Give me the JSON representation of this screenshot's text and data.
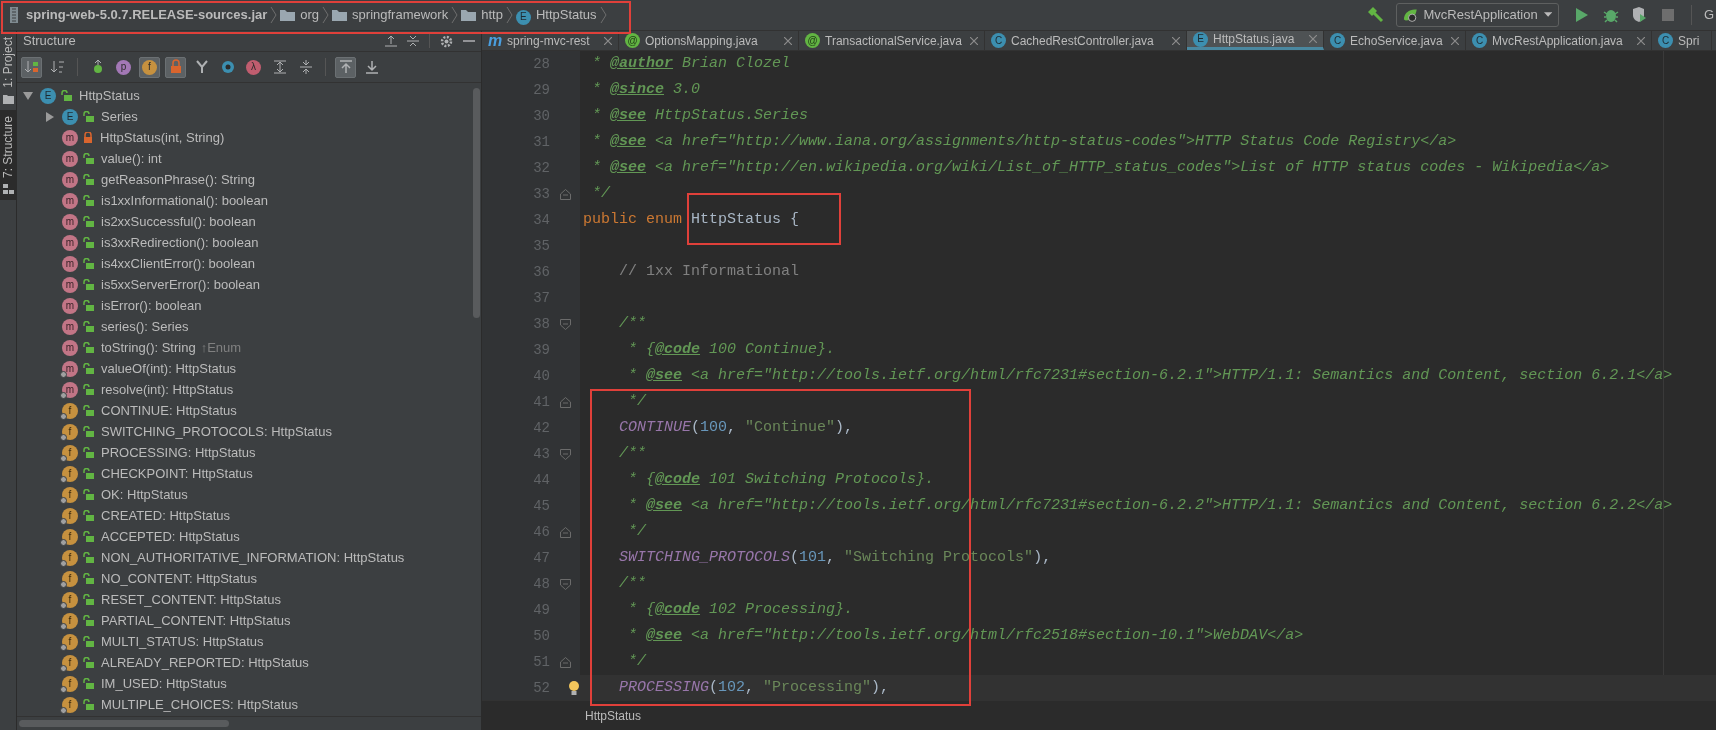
{
  "breadcrumbs": [
    {
      "kind": "jar",
      "label": "spring-web-5.0.7.RELEASE-sources.jar"
    },
    {
      "kind": "package",
      "label": "org"
    },
    {
      "kind": "package",
      "label": "springframework"
    },
    {
      "kind": "package",
      "label": "http"
    },
    {
      "kind": "enum",
      "glyph": "E",
      "label": "HttpStatus"
    }
  ],
  "run_toolbar": {
    "configuration": "MvcRestApplication",
    "cut_label": "G"
  },
  "tool_strip": [
    {
      "label": "1: Project",
      "selected": false
    },
    {
      "label": "7: Structure",
      "selected": true
    }
  ],
  "structure": {
    "title": "Structure",
    "toolbar": [
      {
        "kind": "sort-visibility",
        "active": true
      },
      {
        "kind": "sort-alpha",
        "active": false
      },
      {
        "kind": "inherited",
        "active": false
      },
      {
        "kind": "properties",
        "glyph": "p",
        "active": false
      },
      {
        "kind": "fields",
        "glyph": "f",
        "active": true
      },
      {
        "kind": "non-public",
        "active": true
      },
      {
        "kind": "hierarchy",
        "active": false
      },
      {
        "kind": "anonymous",
        "active": false
      },
      {
        "kind": "lambdas",
        "glyph": "λ",
        "active": false
      },
      {
        "kind": "expand",
        "active": false
      },
      {
        "kind": "collapse",
        "active": false
      },
      {
        "kind": "autoscroll-from",
        "active": true
      },
      {
        "kind": "autoscroll-to",
        "active": false
      }
    ],
    "tree": [
      {
        "label": "HttpStatus",
        "kind": "enum",
        "glyph": "E",
        "private": false,
        "static": false,
        "expanded": true,
        "children": [
          {
            "label": "Series",
            "kind": "enum",
            "glyph": "E",
            "private": false,
            "static": false,
            "expanded": false
          },
          {
            "label": "HttpStatus(int, String)",
            "kind": "method",
            "glyph": "m",
            "private": true,
            "static": false
          },
          {
            "label": "value(): int",
            "kind": "method",
            "glyph": "m",
            "private": false,
            "static": false
          },
          {
            "label": "getReasonPhrase(): String",
            "kind": "method",
            "glyph": "m",
            "private": false,
            "static": false
          },
          {
            "label": "is1xxInformational(): boolean",
            "kind": "method",
            "glyph": "m",
            "private": false,
            "static": false
          },
          {
            "label": "is2xxSuccessful(): boolean",
            "kind": "method",
            "glyph": "m",
            "private": false,
            "static": false
          },
          {
            "label": "is3xxRedirection(): boolean",
            "kind": "method",
            "glyph": "m",
            "private": false,
            "static": false
          },
          {
            "label": "is4xxClientError(): boolean",
            "kind": "method",
            "glyph": "m",
            "private": false,
            "static": false
          },
          {
            "label": "is5xxServerError(): boolean",
            "kind": "method",
            "glyph": "m",
            "private": false,
            "static": false
          },
          {
            "label": "isError(): boolean",
            "kind": "method",
            "glyph": "m",
            "private": false,
            "static": false
          },
          {
            "label": "series(): Series",
            "kind": "method",
            "glyph": "m",
            "private": false,
            "static": false
          },
          {
            "label": "toString(): String",
            "suffix": "↑Enum",
            "kind": "method",
            "glyph": "m",
            "private": false,
            "static": false
          },
          {
            "label": "valueOf(int): HttpStatus",
            "kind": "method",
            "glyph": "m",
            "private": false,
            "static": true
          },
          {
            "label": "resolve(int): HttpStatus",
            "kind": "method",
            "glyph": "m",
            "private": false,
            "static": true
          },
          {
            "label": "CONTINUE: HttpStatus",
            "kind": "field",
            "glyph": "f",
            "private": false,
            "static": true
          },
          {
            "label": "SWITCHING_PROTOCOLS: HttpStatus",
            "kind": "field",
            "glyph": "f",
            "private": false,
            "static": true
          },
          {
            "label": "PROCESSING: HttpStatus",
            "kind": "field",
            "glyph": "f",
            "private": false,
            "static": true
          },
          {
            "label": "CHECKPOINT: HttpStatus",
            "kind": "field",
            "glyph": "f",
            "private": false,
            "static": true
          },
          {
            "label": "OK: HttpStatus",
            "kind": "field",
            "glyph": "f",
            "private": false,
            "static": true
          },
          {
            "label": "CREATED: HttpStatus",
            "kind": "field",
            "glyph": "f",
            "private": false,
            "static": true
          },
          {
            "label": "ACCEPTED: HttpStatus",
            "kind": "field",
            "glyph": "f",
            "private": false,
            "static": true
          },
          {
            "label": "NON_AUTHORITATIVE_INFORMATION: HttpStatus",
            "kind": "field",
            "glyph": "f",
            "private": false,
            "static": true
          },
          {
            "label": "NO_CONTENT: HttpStatus",
            "kind": "field",
            "glyph": "f",
            "private": false,
            "static": true
          },
          {
            "label": "RESET_CONTENT: HttpStatus",
            "kind": "field",
            "glyph": "f",
            "private": false,
            "static": true
          },
          {
            "label": "PARTIAL_CONTENT: HttpStatus",
            "kind": "field",
            "glyph": "f",
            "private": false,
            "static": true
          },
          {
            "label": "MULTI_STATUS: HttpStatus",
            "kind": "field",
            "glyph": "f",
            "private": false,
            "static": true
          },
          {
            "label": "ALREADY_REPORTED: HttpStatus",
            "kind": "field",
            "glyph": "f",
            "private": false,
            "static": true
          },
          {
            "label": "IM_USED: HttpStatus",
            "kind": "field",
            "glyph": "f",
            "private": false,
            "static": true
          },
          {
            "label": "MULTIPLE_CHOICES: HttpStatus",
            "kind": "field",
            "glyph": "f",
            "private": false,
            "static": true
          }
        ]
      }
    ]
  },
  "editor": {
    "tabs": [
      {
        "label": "spring-mvc-rest",
        "kind": "module",
        "glyph": "m",
        "selected": false,
        "closable": true
      },
      {
        "label": "OptionsMapping.java",
        "kind": "annotation",
        "glyph": "@",
        "selected": false,
        "closable": true
      },
      {
        "label": "TransactionalService.java",
        "kind": "annotation",
        "glyph": "@",
        "selected": false,
        "closable": true
      },
      {
        "label": "CachedRestController.java",
        "kind": "class",
        "glyph": "C",
        "selected": false,
        "closable": true
      },
      {
        "label": "HttpStatus.java",
        "kind": "enum",
        "glyph": "E",
        "selected": true,
        "closable": true
      },
      {
        "label": "EchoService.java",
        "kind": "class",
        "glyph": "C",
        "selected": false,
        "closable": true
      },
      {
        "label": "MvcRestApplication.java",
        "kind": "class",
        "glyph": "C",
        "selected": false,
        "closable": true
      },
      {
        "label": "Spri",
        "kind": "class",
        "glyph": "C",
        "selected": false,
        "closable": false
      }
    ],
    "lines": [
      {
        "number": "28",
        "fold_start": false,
        "fold_end": false,
        "current": false,
        "tokens": [
          {
            "kind": "doc",
            "text": " * "
          },
          {
            "kind": "tag",
            "text": "@author"
          },
          {
            "kind": "doc",
            "text": " Brian Clozel"
          }
        ]
      },
      {
        "number": "29",
        "fold_start": false,
        "fold_end": false,
        "current": false,
        "tokens": [
          {
            "kind": "doc",
            "text": " * "
          },
          {
            "kind": "tag",
            "text": "@since"
          },
          {
            "kind": "doc",
            "text": " 3.0"
          }
        ]
      },
      {
        "number": "30",
        "fold_start": false,
        "fold_end": false,
        "current": false,
        "tokens": [
          {
            "kind": "doc",
            "text": " * "
          },
          {
            "kind": "tag",
            "text": "@see"
          },
          {
            "kind": "doc",
            "text": " HttpStatus.Series"
          }
        ]
      },
      {
        "number": "31",
        "fold_start": false,
        "fold_end": false,
        "current": false,
        "tokens": [
          {
            "kind": "doc",
            "text": " * "
          },
          {
            "kind": "tag",
            "text": "@see"
          },
          {
            "kind": "doc",
            "text": " <a href=\"http://www.iana.org/assignments/http-status-codes\">HTTP Status Code Registry</a>"
          }
        ]
      },
      {
        "number": "32",
        "fold_start": false,
        "fold_end": false,
        "current": false,
        "tokens": [
          {
            "kind": "doc",
            "text": " * "
          },
          {
            "kind": "tag",
            "text": "@see"
          },
          {
            "kind": "doc",
            "text": " <a href=\"http://en.wikipedia.org/wiki/List_of_HTTP_status_codes\">List of HTTP status codes - Wikipedia</a>"
          }
        ]
      },
      {
        "number": "33",
        "fold_start": false,
        "fold_end": true,
        "current": false,
        "tokens": [
          {
            "kind": "doc",
            "text": " */"
          }
        ]
      },
      {
        "number": "34",
        "fold_start": false,
        "fold_end": false,
        "current": false,
        "tokens": [
          {
            "kind": "keyword",
            "text": "public enum "
          },
          {
            "kind": "plain",
            "text": "HttpStatus {"
          }
        ]
      },
      {
        "number": "35",
        "fold_start": false,
        "fold_end": false,
        "current": false
      },
      {
        "number": "36",
        "fold_start": false,
        "fold_end": false,
        "current": false,
        "tokens": [
          {
            "kind": "comment",
            "text": "    // 1xx Informational"
          }
        ]
      },
      {
        "number": "37",
        "fold_start": false,
        "fold_end": false,
        "current": false
      },
      {
        "number": "38",
        "fold_start": true,
        "fold_end": false,
        "current": false,
        "tokens": [
          {
            "kind": "doc",
            "text": "    /**"
          }
        ]
      },
      {
        "number": "39",
        "fold_start": false,
        "fold_end": false,
        "current": false,
        "tokens": [
          {
            "kind": "doc",
            "text": "     * {"
          },
          {
            "kind": "tag",
            "text": "@code"
          },
          {
            "kind": "doc",
            "text": " 100 Continue}."
          }
        ]
      },
      {
        "number": "40",
        "fold_start": false,
        "fold_end": false,
        "current": false,
        "tokens": [
          {
            "kind": "doc",
            "text": "     * "
          },
          {
            "kind": "tag",
            "text": "@see"
          },
          {
            "kind": "doc",
            "text": " <a href=\"http://tools.ietf.org/html/rfc7231#section-6.2.1\">HTTP/1.1: Semantics and Content, section 6.2.1</a>"
          }
        ]
      },
      {
        "number": "41",
        "fold_start": false,
        "fold_end": true,
        "current": false,
        "tokens": [
          {
            "kind": "doc",
            "text": "     */"
          }
        ]
      },
      {
        "number": "42",
        "fold_start": false,
        "fold_end": false,
        "current": false,
        "tokens": [
          {
            "kind": "constant",
            "text": "    CONTINUE"
          },
          {
            "kind": "plain",
            "text": "("
          },
          {
            "kind": "number",
            "text": "100"
          },
          {
            "kind": "plain",
            "text": ", "
          },
          {
            "kind": "string",
            "text": "\"Continue\""
          },
          {
            "kind": "plain",
            "text": "),"
          }
        ]
      },
      {
        "number": "43",
        "fold_start": true,
        "fold_end": false,
        "current": false,
        "tokens": [
          {
            "kind": "doc",
            "text": "    /**"
          }
        ]
      },
      {
        "number": "44",
        "fold_start": false,
        "fold_end": false,
        "current": false,
        "tokens": [
          {
            "kind": "doc",
            "text": "     * {"
          },
          {
            "kind": "tag",
            "text": "@code"
          },
          {
            "kind": "doc",
            "text": " 101 Switching Protocols}."
          }
        ]
      },
      {
        "number": "45",
        "fold_start": false,
        "fold_end": false,
        "current": false,
        "tokens": [
          {
            "kind": "doc",
            "text": "     * "
          },
          {
            "kind": "tag",
            "text": "@see"
          },
          {
            "kind": "doc",
            "text": " <a href=\"http://tools.ietf.org/html/rfc7231#section-6.2.2\">HTTP/1.1: Semantics and Content, section 6.2.2</a>"
          }
        ]
      },
      {
        "number": "46",
        "fold_start": false,
        "fold_end": true,
        "current": false,
        "tokens": [
          {
            "kind": "doc",
            "text": "     */"
          }
        ]
      },
      {
        "number": "47",
        "fold_start": false,
        "fold_end": false,
        "current": false,
        "tokens": [
          {
            "kind": "constant",
            "text": "    SWITCHING_PROTOCOLS"
          },
          {
            "kind": "plain",
            "text": "("
          },
          {
            "kind": "number",
            "text": "101"
          },
          {
            "kind": "plain",
            "text": ", "
          },
          {
            "kind": "string",
            "text": "\"Switching Protocols\""
          },
          {
            "kind": "plain",
            "text": "),"
          }
        ]
      },
      {
        "number": "48",
        "fold_start": true,
        "fold_end": false,
        "current": false,
        "tokens": [
          {
            "kind": "doc",
            "text": "    /**"
          }
        ]
      },
      {
        "number": "49",
        "fold_start": false,
        "fold_end": false,
        "current": false,
        "tokens": [
          {
            "kind": "doc",
            "text": "     * {"
          },
          {
            "kind": "tag",
            "text": "@code"
          },
          {
            "kind": "doc",
            "text": " 102 Processing}."
          }
        ]
      },
      {
        "number": "50",
        "fold_start": false,
        "fold_end": false,
        "current": false,
        "tokens": [
          {
            "kind": "doc",
            "text": "     * "
          },
          {
            "kind": "tag",
            "text": "@see"
          },
          {
            "kind": "doc",
            "text": " <a href=\"http://tools.ietf.org/html/rfc2518#section-10.1\">WebDAV</a>"
          }
        ]
      },
      {
        "number": "51",
        "fold_start": false,
        "fold_end": true,
        "current": false,
        "tokens": [
          {
            "kind": "doc",
            "text": "     */"
          }
        ]
      },
      {
        "number": "52",
        "fold_start": false,
        "fold_end": false,
        "current": true,
        "tokens": [
          {
            "kind": "constant",
            "text": "    PROCESSING"
          },
          {
            "kind": "plain",
            "text": "("
          },
          {
            "kind": "number",
            "text": "102"
          },
          {
            "kind": "plain",
            "text": ", "
          },
          {
            "kind": "string",
            "text": "\"Processing\""
          },
          {
            "kind": "plain",
            "text": "),"
          }
        ]
      }
    ],
    "breadcrumb": "HttpStatus"
  }
}
